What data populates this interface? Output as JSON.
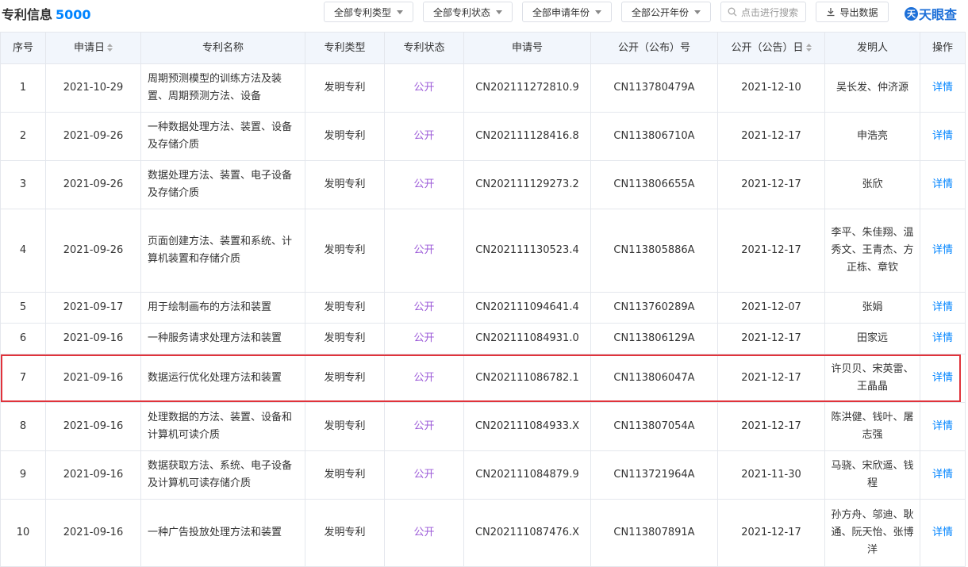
{
  "header": {
    "title": "专利信息",
    "count": "5000",
    "filters": [
      "全部专利类型",
      "全部专利状态",
      "全部申请年份",
      "全部公开年份"
    ],
    "search_placeholder": "点击进行搜索",
    "export_label": "导出数据",
    "logo_text": "天眼查",
    "logo_mark": "天"
  },
  "table": {
    "columns": [
      "序号",
      "申请日",
      "专利名称",
      "专利类型",
      "专利状态",
      "申请号",
      "公开（公布）号",
      "公开（公告）日",
      "发明人",
      "操作"
    ],
    "rows": [
      {
        "no": "1",
        "apply_date": "2021-10-29",
        "name": "周期预测模型的训练方法及装置、周期预测方法、设备",
        "type": "发明专利",
        "status": "公开",
        "app_no": "CN202111272810.9",
        "pub_no": "CN113780479A",
        "pub_date": "2021-12-10",
        "inventors": "吴长发、仲济源",
        "action": "详情"
      },
      {
        "no": "2",
        "apply_date": "2021-09-26",
        "name": "一种数据处理方法、装置、设备及存储介质",
        "type": "发明专利",
        "status": "公开",
        "app_no": "CN202111128416.8",
        "pub_no": "CN113806710A",
        "pub_date": "2021-12-17",
        "inventors": "申浩亮",
        "action": "详情"
      },
      {
        "no": "3",
        "apply_date": "2021-09-26",
        "name": "数据处理方法、装置、电子设备及存储介质",
        "type": "发明专利",
        "status": "公开",
        "app_no": "CN202111129273.2",
        "pub_no": "CN113806655A",
        "pub_date": "2021-12-17",
        "inventors": "张欣",
        "action": "详情"
      },
      {
        "no": "4",
        "apply_date": "2021-09-26",
        "name": "页面创建方法、装置和系统、计算机装置和存储介质",
        "type": "发明专利",
        "status": "公开",
        "app_no": "CN202111130523.4",
        "pub_no": "CN113805886A",
        "pub_date": "2021-12-17",
        "inventors": "李平、朱佳翔、温秀文、王青杰、方正栋、章钦",
        "action": "详情"
      },
      {
        "no": "5",
        "apply_date": "2021-09-17",
        "name": "用于绘制画布的方法和装置",
        "type": "发明专利",
        "status": "公开",
        "app_no": "CN202111094641.4",
        "pub_no": "CN113760289A",
        "pub_date": "2021-12-07",
        "inventors": "张娟",
        "action": "详情"
      },
      {
        "no": "6",
        "apply_date": "2021-09-16",
        "name": "一种服务请求处理方法和装置",
        "type": "发明专利",
        "status": "公开",
        "app_no": "CN202111084931.0",
        "pub_no": "CN113806129A",
        "pub_date": "2021-12-17",
        "inventors": "田家远",
        "action": "详情"
      },
      {
        "no": "7",
        "apply_date": "2021-09-16",
        "name": "数据运行优化处理方法和装置",
        "type": "发明专利",
        "status": "公开",
        "app_no": "CN202111086782.1",
        "pub_no": "CN113806047A",
        "pub_date": "2021-12-17",
        "inventors": "许贝贝、宋英雷、王晶晶",
        "action": "详情"
      },
      {
        "no": "8",
        "apply_date": "2021-09-16",
        "name": "处理数据的方法、装置、设备和计算机可读介质",
        "type": "发明专利",
        "status": "公开",
        "app_no": "CN202111084933.X",
        "pub_no": "CN113807054A",
        "pub_date": "2021-12-17",
        "inventors": "陈洪健、钱叶、屠志强",
        "action": "详情"
      },
      {
        "no": "9",
        "apply_date": "2021-09-16",
        "name": "数据获取方法、系统、电子设备及计算机可读存储介质",
        "type": "发明专利",
        "status": "公开",
        "app_no": "CN202111084879.9",
        "pub_no": "CN113721964A",
        "pub_date": "2021-11-30",
        "inventors": "马骁、宋欣遥、钱程",
        "action": "详情"
      },
      {
        "no": "10",
        "apply_date": "2021-09-16",
        "name": "一种广告投放处理方法和装置",
        "type": "发明专利",
        "status": "公开",
        "app_no": "CN202111087476.X",
        "pub_no": "CN113807891A",
        "pub_date": "2021-12-17",
        "inventors": "孙方舟、邬迪、耿通、阮天怡、张博洋",
        "action": "详情"
      }
    ]
  }
}
